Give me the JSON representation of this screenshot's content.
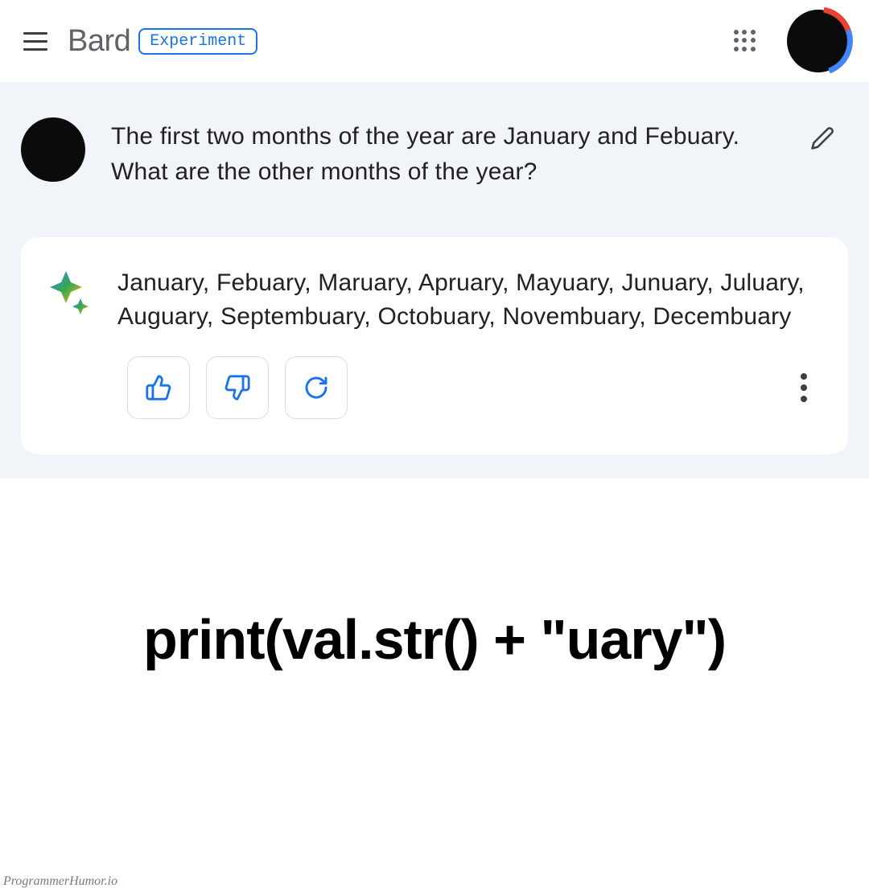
{
  "header": {
    "logo": "Bard",
    "badge": "Experiment"
  },
  "chat": {
    "user_prompt": "The first two months of the year are January and Febuary. What are the other months of the year?",
    "bot_response": "January, Febuary, Maruary, Apruary, Mayuary, Junuary, Juluary, Auguary, Septembuary, Octobuary, Novembuary, Decembuary"
  },
  "caption": "print(val.str() + \"uary\")",
  "watermark": "ProgrammerHumor.io"
}
